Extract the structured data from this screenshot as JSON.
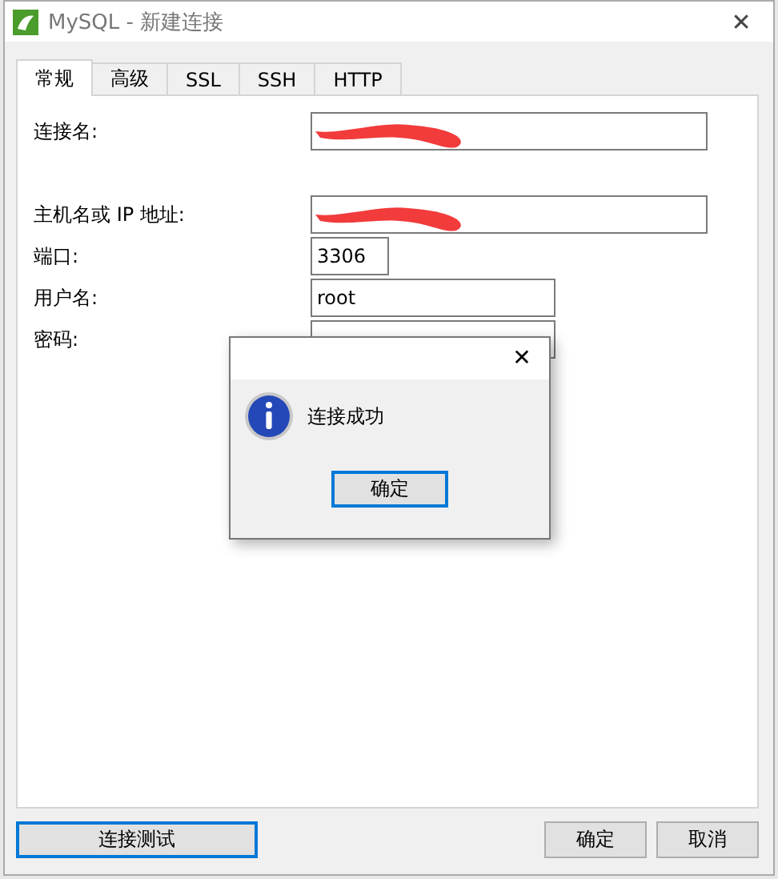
{
  "window": {
    "title": "MySQL - 新建连接",
    "close": "✕"
  },
  "tabs": [
    {
      "label": "常规",
      "selected": true
    },
    {
      "label": "高级",
      "selected": false
    },
    {
      "label": "SSL",
      "selected": false
    },
    {
      "label": "SSH",
      "selected": false
    },
    {
      "label": "HTTP",
      "selected": false
    }
  ],
  "fields": [
    {
      "label": "连接名:",
      "redacted": true
    },
    {
      "label": "主机名或 IP 地址:",
      "redacted": true
    },
    {
      "label": "端口:",
      "value": "3306"
    },
    {
      "label": "用户名:",
      "value": "root"
    },
    {
      "label": "密码:"
    }
  ],
  "dialog": {
    "close": "✕",
    "message": "连接成功",
    "button": "确定"
  },
  "footer": {
    "test_button": "连接测试",
    "buttons": [
      "确定",
      "取消"
    ]
  }
}
